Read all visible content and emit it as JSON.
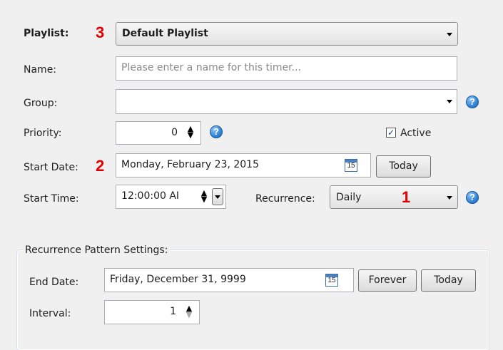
{
  "annotations": {
    "a1": "1",
    "a2": "2",
    "a3": "3"
  },
  "playlist": {
    "label": "Playlist:",
    "value": "Default Playlist"
  },
  "name": {
    "label": "Name:",
    "placeholder": "Please enter a name for this timer..."
  },
  "group": {
    "label": "Group:",
    "value": ""
  },
  "priority": {
    "label": "Priority:",
    "value": "0"
  },
  "active": {
    "label": "Active",
    "checked": true
  },
  "start_date": {
    "label": "Start Date:",
    "value": "Monday, February 23, 2015",
    "today_label": "Today"
  },
  "start_time": {
    "label": "Start Time:",
    "value": "12:00:00 AI"
  },
  "recurrence": {
    "label": "Recurrence:",
    "value": "Daily"
  },
  "pattern": {
    "title": "Recurrence Pattern Settings:",
    "end_date": {
      "label": "End Date:",
      "value": "Friday, December 31, 9999",
      "forever_label": "Forever",
      "today_label": "Today"
    },
    "interval": {
      "label": "Interval:",
      "value": "1"
    }
  },
  "icons": {
    "help": "help-icon",
    "calendar": "calendar-icon",
    "calendar_day": "15",
    "help_glyph": "?",
    "check_glyph": "✓"
  },
  "colors": {
    "annotation": "#e00000",
    "help": "#2e7fd3"
  }
}
